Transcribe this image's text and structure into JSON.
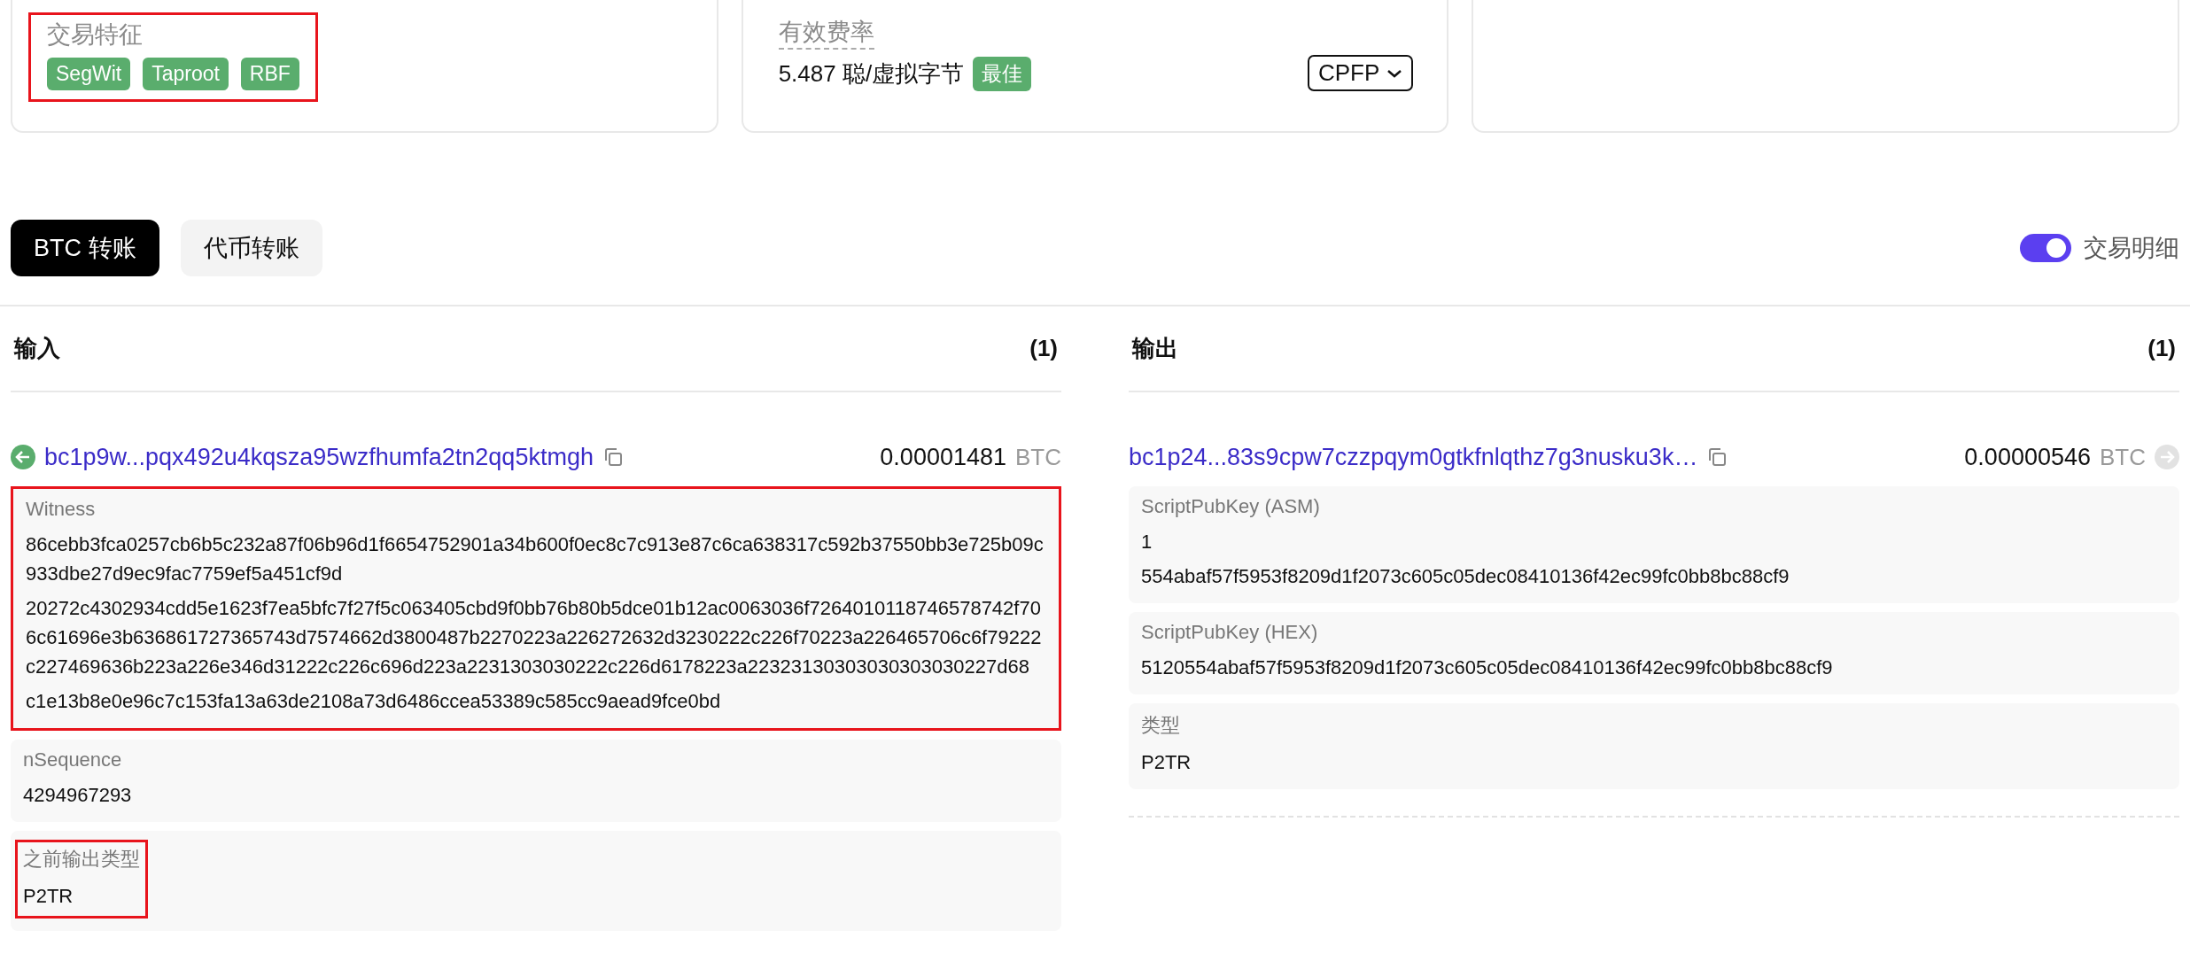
{
  "summary_cards": [
    {
      "kind": "tags",
      "label": "交易特征",
      "framed": true,
      "tags": [
        "SegWit",
        "Taproot",
        "RBF"
      ]
    },
    {
      "kind": "fee",
      "label": "有效费率",
      "value": "5.487 聪/虚拟字节",
      "badge": "最佳",
      "dropdown": "CPFP"
    },
    {
      "kind": "empty"
    }
  ],
  "tabs": [
    {
      "label": "BTC 转账",
      "selected": true
    },
    {
      "label": "代币转账",
      "selected": false
    }
  ],
  "details_toggle": {
    "label": "交易明细",
    "on": true
  },
  "columns": [
    {
      "kind": "input",
      "title": "输入",
      "count": "(1)",
      "items": [
        {
          "address": "bc1p9w...pqx492u4kqsza95wzfhumfa2tn2qq5ktmgh",
          "amount": "0.00001481",
          "unit": "BTC",
          "fields": [
            {
              "label": "Witness",
              "framed": true,
              "values": [
                "86cebb3fca0257cb6b5c232a87f06b96d1f6654752901a34b600f0ec8c7c913e87c6ca638317c592b37550bb3e725b09c933dbe27d9ec9fac7759ef5a451cf9d",
                "20272c4302934cdd5e1623f7ea5bfc7f27f5c063405cbd9f0bb76b80b5dce01b12ac0063036f7264010118746578742f706c61696e3b636861727365743d7574662d3800487b2270223a226272632d3230222c226f70223a226465706c6f79222c227469636b223a226e346d31222c226c696d223a2231303030222c226d6178223a22323130303030303030227d68",
                "c1e13b8e0e96c7c153fa13a63de2108a73d6486ccea53389c585cc9aead9fce0bd"
              ]
            },
            {
              "label": "nSequence",
              "values": [
                "4294967293"
              ]
            },
            {
              "label": "之前输出类型",
              "text_framed": true,
              "values": [
                "P2TR"
              ]
            }
          ]
        }
      ]
    },
    {
      "kind": "output",
      "title": "输出",
      "count": "(1)",
      "items": [
        {
          "address": "bc1p24...83s9cpw7czzpqym0gtkfnlqthz7g3nusku3k…",
          "amount": "0.00000546",
          "unit": "BTC",
          "fields": [
            {
              "label": "ScriptPubKey (ASM)",
              "values": [
                "1",
                "554abaf57f5953f8209d1f2073c605c05dec08410136f42ec99fc0bb8bc88cf9"
              ]
            },
            {
              "label": "ScriptPubKey (HEX)",
              "values": [
                "5120554abaf57f5953f8209d1f2073c605c05dec08410136f42ec99fc0bb8bc88cf9"
              ]
            },
            {
              "label": "类型",
              "values": [
                "P2TR"
              ]
            }
          ]
        }
      ]
    }
  ]
}
